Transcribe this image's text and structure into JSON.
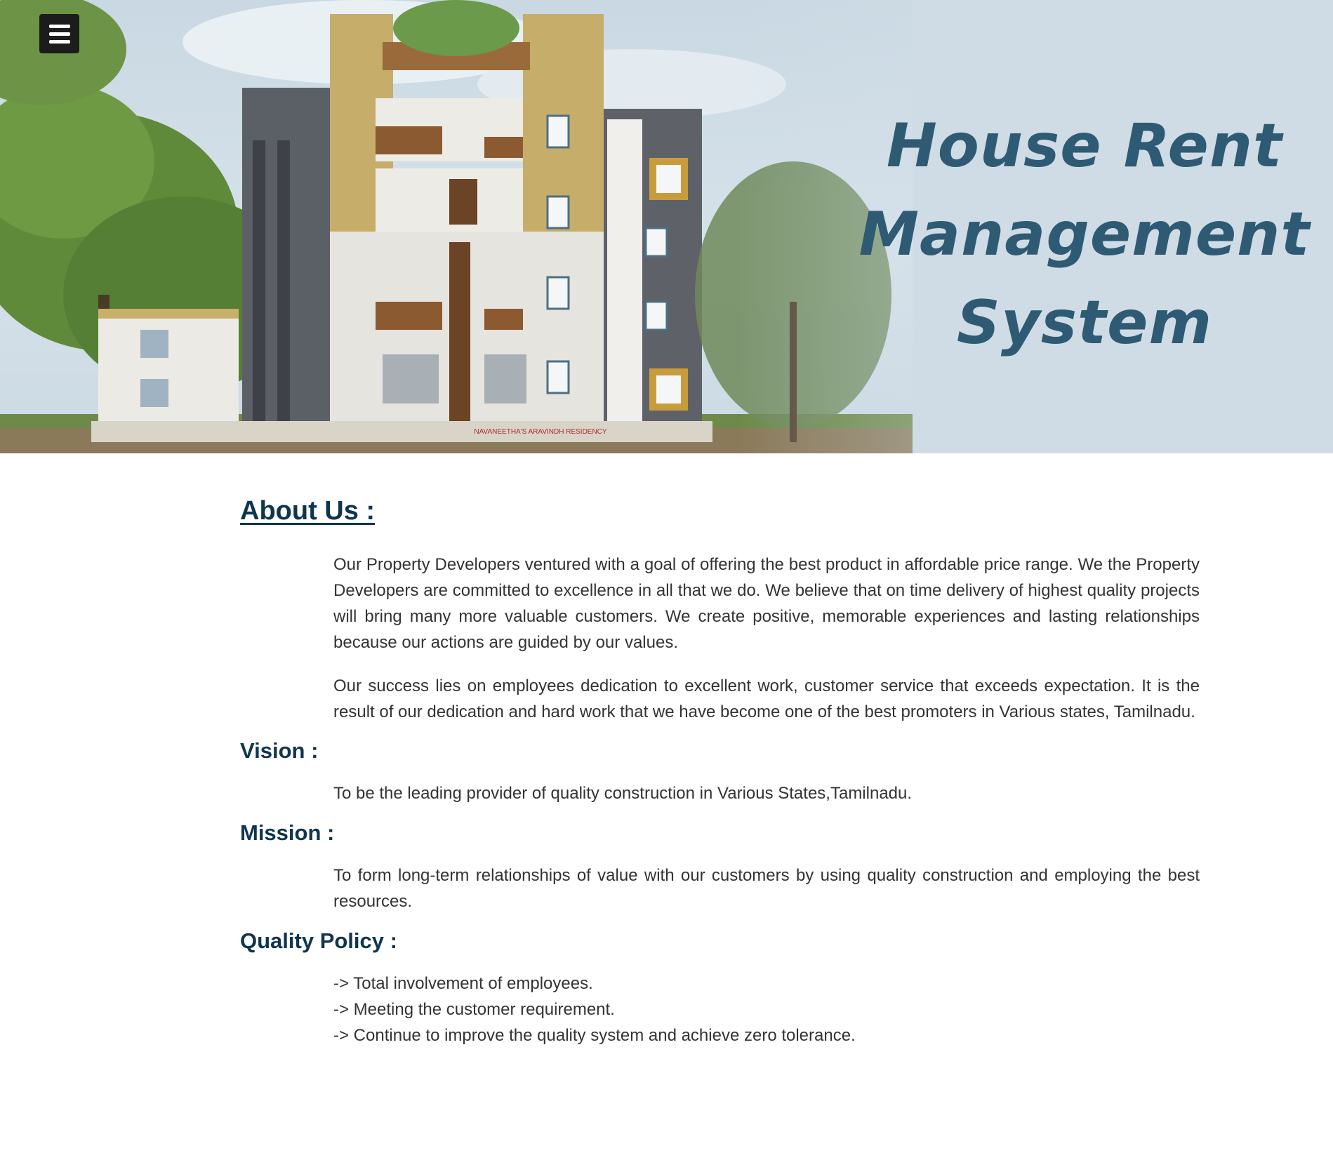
{
  "banner": {
    "title_lines": [
      "House Rent",
      "Management",
      "System"
    ],
    "building_sign": "NAVANEETHA'S ARAVINDH RESIDENCY"
  },
  "menu": {
    "icon": "hamburger-menu-icon"
  },
  "about": {
    "heading": "About Us :",
    "paragraphs": [
      "Our Property Developers ventured with a goal of offering the best product in affordable price range. We the Property Developers are committed to excellence in all that we do. We believe that on time delivery of highest quality projects will bring many more valuable customers. We create positive, memorable experiences and lasting relationships because our actions are guided by our values.",
      "Our success lies on employees dedication to excellent work, customer service that exceeds expectation. It is the result of our dedication and hard work that we have become one of the best promoters in Various states, Tamilnadu."
    ]
  },
  "vision": {
    "heading": "Vision :",
    "text": "To be the leading provider of quality construction in Various States,Tamilnadu."
  },
  "mission": {
    "heading": "Mission :",
    "text": "To form long-term relationships of value with our customers by using quality construction and employing the best resources."
  },
  "quality_policy": {
    "heading": "Quality Policy :",
    "items": [
      "-> Total involvement of employees.",
      "-> Meeting the customer requirement.",
      "-> Continue to improve the quality system and achieve zero tolerance."
    ]
  },
  "colors": {
    "heading": "#0f3550",
    "body_text": "#333333",
    "banner_title": "#2f5a73",
    "menu_button": "#1c1c1c"
  }
}
